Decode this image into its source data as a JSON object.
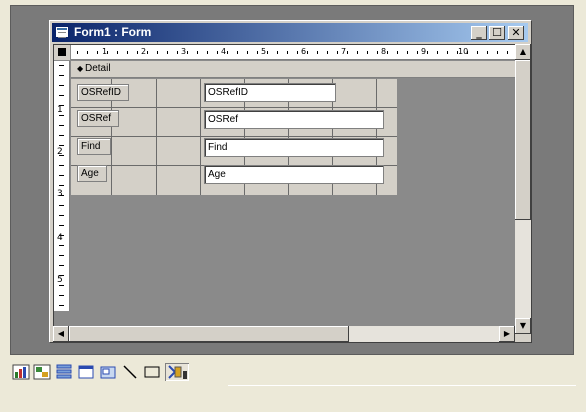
{
  "window": {
    "title": "Form1 : Form",
    "min_label": "_",
    "max_label": "☐",
    "close_label": "✕"
  },
  "ruler": {
    "h_numbers": [
      "1",
      "2",
      "3",
      "4",
      "5",
      "6",
      "7",
      "8",
      "9",
      "10"
    ],
    "v_numbers": [
      "1",
      "2",
      "3",
      "4",
      "5"
    ]
  },
  "section": {
    "label": "Detail"
  },
  "fields": [
    {
      "label": "OSRefID",
      "value": "OSRefID"
    },
    {
      "label": "OSRef",
      "value": "OSRef"
    },
    {
      "label": "Find",
      "value": "Find"
    },
    {
      "label": "Age",
      "value": "Age"
    }
  ],
  "toolbox": {
    "items": [
      "chart-icon",
      "unbound-object-frame-icon",
      "bound-object-frame-icon",
      "page-break-icon",
      "tab-control-icon",
      "line-icon",
      "rectangle-icon",
      "more-controls-icon"
    ]
  }
}
